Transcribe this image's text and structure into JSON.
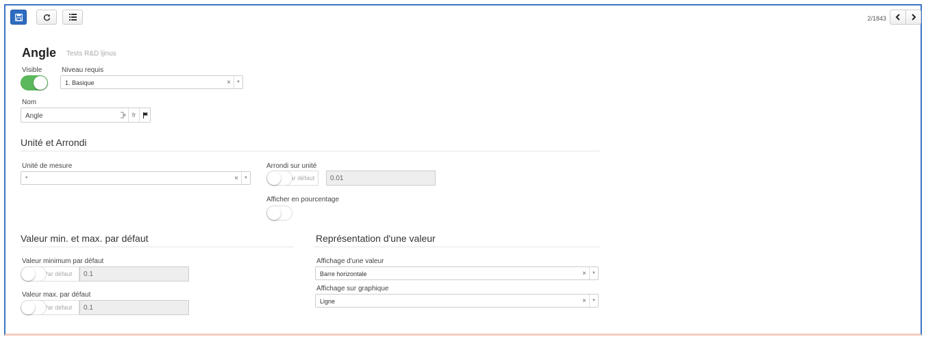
{
  "toolbar": {
    "save_icon": "save-icon",
    "refresh_icon": "refresh-icon",
    "list_icon": "list-icon"
  },
  "pager": {
    "position": "2/1843",
    "prev_icon": "chevron-left-icon",
    "next_icon": "chevron-right-icon"
  },
  "header": {
    "title": "Angle",
    "subtitle": "Tests R&D ljinus"
  },
  "visible": {
    "label": "Visible",
    "on": true
  },
  "niveau": {
    "label": "Niveau requis",
    "value": "1. Basique",
    "clear": "×",
    "arrow": "▼"
  },
  "nom": {
    "label": "Nom",
    "value": "Angle",
    "addon_translate_icon": "translate-icon",
    "addon_lang": "fr",
    "addon_flag_icon": "flag-icon"
  },
  "section_unit": {
    "title": "Unité et Arrondi"
  },
  "unite": {
    "label": "Unité de mesure",
    "value": "°",
    "clear": "×",
    "arrow": "▼"
  },
  "arrondi": {
    "label": "Arrondi sur unité",
    "default_label": "Par défaut",
    "value": "0.01"
  },
  "pourcentage": {
    "label": "Afficher en pourcentage",
    "on": false
  },
  "section_minmax": {
    "title": "Valeur min. et max. par défaut"
  },
  "min_default": {
    "label": "Valeur minimum par défaut",
    "default_label": "Par défaut",
    "value": "0.1"
  },
  "max_default": {
    "label": "Valeur max. par défaut",
    "default_label": "Par défaut",
    "value": "0.1"
  },
  "section_repr": {
    "title": "Représentation d'une valeur"
  },
  "affichage_valeur": {
    "label": "Affichage d'une valeur",
    "value": "Barre horizontale",
    "clear": "×",
    "arrow": "▼"
  },
  "affichage_graph": {
    "label": "Affichage sur graphique",
    "value": "Ligne",
    "clear": "×",
    "arrow": "▼"
  },
  "colors": {
    "primary": "#2d6cc0",
    "toggle_on": "#5cb85c",
    "frame": "#3a73c4"
  }
}
